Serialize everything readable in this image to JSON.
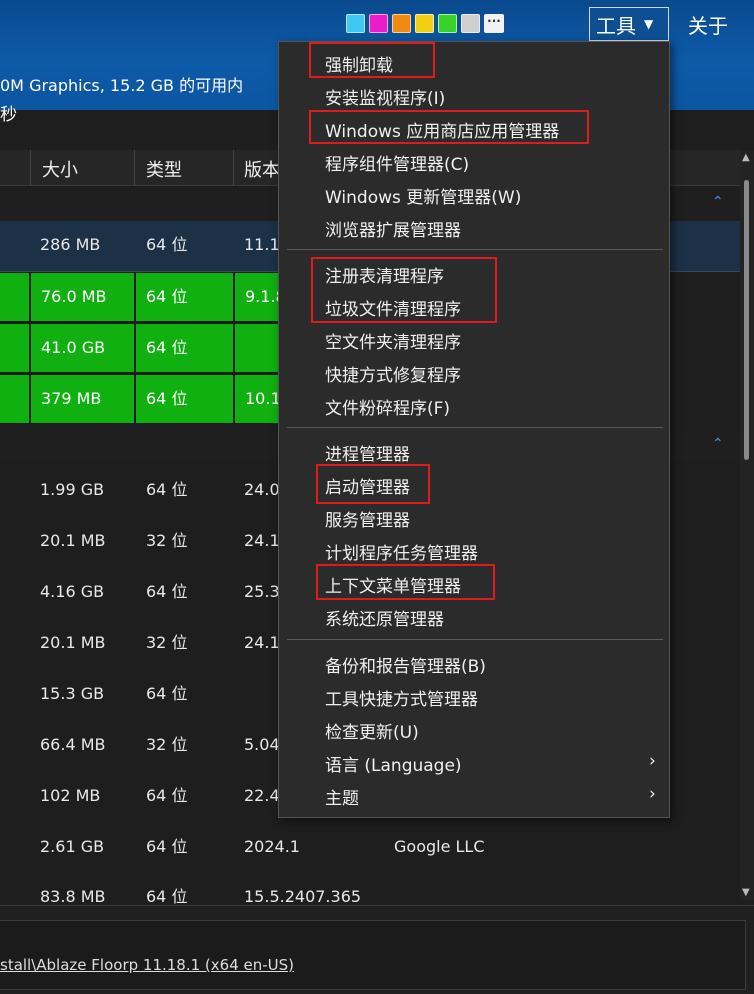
{
  "header": {
    "swatches": [
      "#3ec8f5",
      "#e91ec8",
      "#f08a12",
      "#f2cf12",
      "#36d42b",
      "#cfcfcf"
    ],
    "more_label": "···",
    "tools_label": "工具",
    "about_label": "关于",
    "sysinfo_line1": "0M Graphics, 15.2 GB 的可用内",
    "sysinfo_line2": "秒"
  },
  "table": {
    "columns": [
      "大小",
      "类型",
      "版本"
    ],
    "rows": [
      {
        "size": "286 MB",
        "type": "64 位",
        "version": "11.1",
        "state": "selected"
      },
      {
        "size": "76.0 MB",
        "type": "64 位",
        "version": "9.1.8",
        "state": "green"
      },
      {
        "size": "41.0 GB",
        "type": "64 位",
        "version": "",
        "state": "green"
      },
      {
        "size": "379 MB",
        "type": "64 位",
        "version": "10.1",
        "state": "green"
      },
      {
        "size": "1.99 GB",
        "type": "64 位",
        "version": "24.0",
        "state": ""
      },
      {
        "size": "20.1 MB",
        "type": "32 位",
        "version": "24.1",
        "state": ""
      },
      {
        "size": "4.16 GB",
        "type": "64 位",
        "version": "25.3",
        "state": ""
      },
      {
        "size": "20.1 MB",
        "type": "32 位",
        "version": "24.1",
        "state": ""
      },
      {
        "size": "15.3 GB",
        "type": "64 位",
        "version": "",
        "state": ""
      },
      {
        "size": "66.4 MB",
        "type": "32 位",
        "version": "5.04",
        "state": ""
      },
      {
        "size": "102 MB",
        "type": "64 位",
        "version": "22.4",
        "state": ""
      },
      {
        "size": "2.61 GB",
        "type": "64 位",
        "version": "2024.1",
        "publisher": "Google LLC",
        "state": ""
      },
      {
        "size": "83.8 MB",
        "type": "64 位",
        "version": "15.5.2407.365",
        "state": ""
      }
    ]
  },
  "footer": {
    "install_path": "stall\\Ablaze Floorp 11.18.1 (x64 en-US)"
  },
  "menu": {
    "items": [
      {
        "label": "强制卸载",
        "highlighted": true
      },
      {
        "label": "安装监视程序(I)",
        "highlighted": false
      },
      {
        "label": "Windows 应用商店应用管理器",
        "highlighted": true
      },
      {
        "label": "程序组件管理器(C)",
        "highlighted": false
      },
      {
        "label": "Windows 更新管理器(W)",
        "highlighted": false
      },
      {
        "label": "浏览器扩展管理器",
        "highlighted": false
      },
      {
        "label": "注册表清理程序",
        "highlighted": true
      },
      {
        "label": "垃圾文件清理程序",
        "highlighted": true
      },
      {
        "label": "空文件夹清理程序",
        "highlighted": false
      },
      {
        "label": "快捷方式修复程序",
        "highlighted": false
      },
      {
        "label": "文件粉碎程序(F)",
        "highlighted": false
      },
      {
        "label": "进程管理器",
        "highlighted": false
      },
      {
        "label": "启动管理器",
        "highlighted": true
      },
      {
        "label": "服务管理器",
        "highlighted": false
      },
      {
        "label": "计划程序任务管理器",
        "highlighted": false
      },
      {
        "label": "上下文菜单管理器",
        "highlighted": true
      },
      {
        "label": "系统还原管理器",
        "highlighted": false
      },
      {
        "label": "备份和报告管理器(B)",
        "highlighted": false
      },
      {
        "label": "工具快捷方式管理器",
        "highlighted": false
      },
      {
        "label": "检查更新(U)",
        "highlighted": false
      },
      {
        "label": "语言 (Language)",
        "highlighted": false,
        "submenu": true
      },
      {
        "label": "主题",
        "highlighted": false,
        "submenu": true
      }
    ],
    "highlight_color": "#e01b1b"
  }
}
